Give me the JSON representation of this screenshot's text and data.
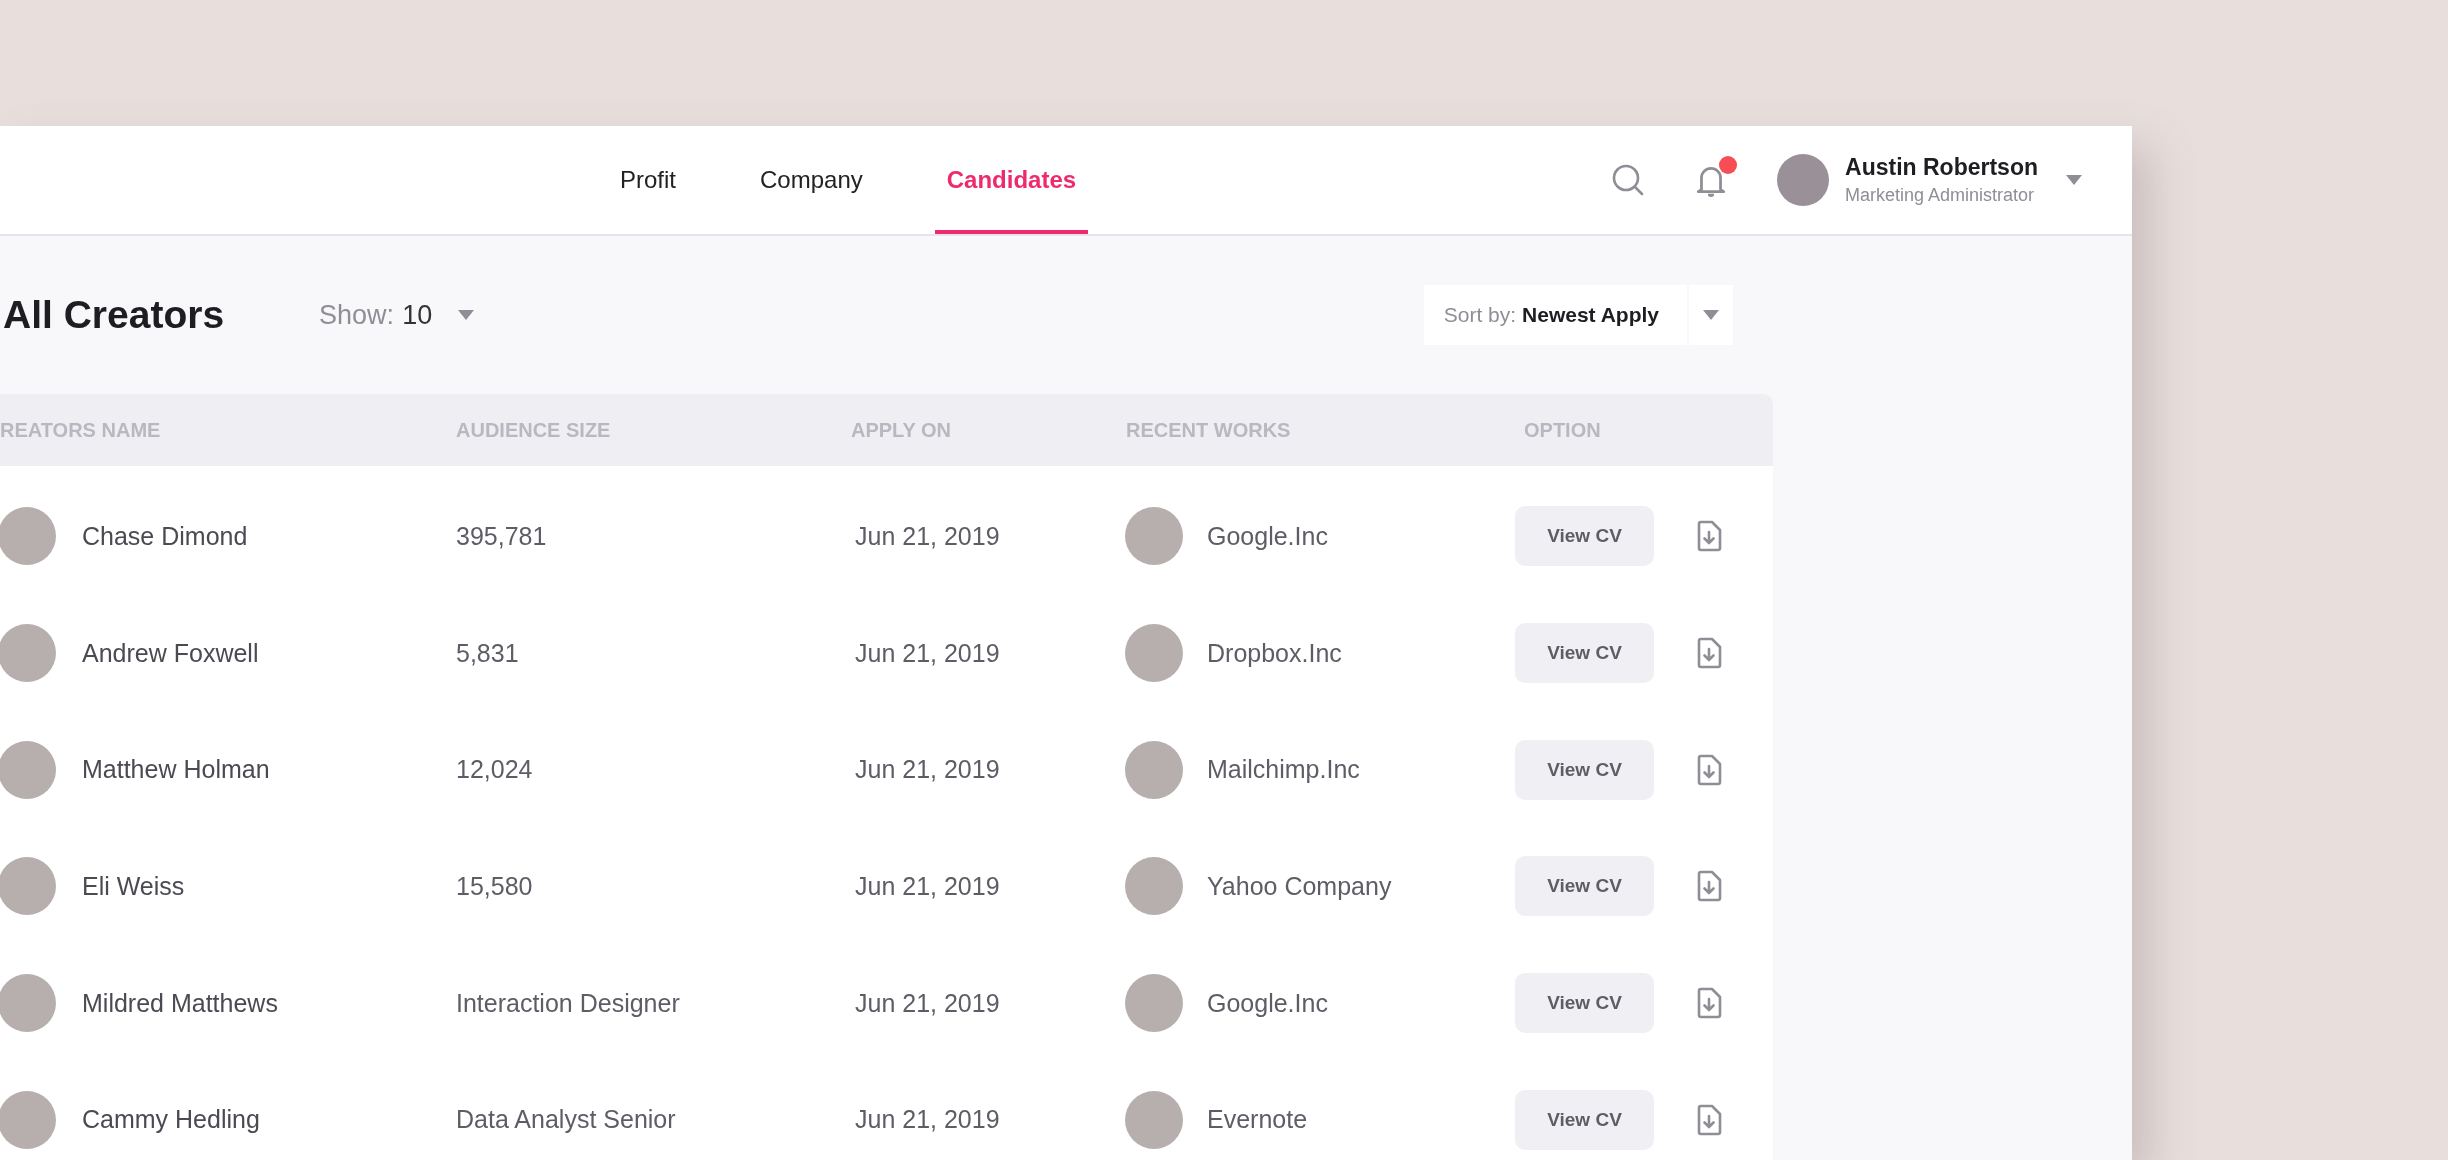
{
  "nav": {
    "tabs": [
      {
        "label": "Profit",
        "selected": false
      },
      {
        "label": "Company",
        "selected": false
      },
      {
        "label": "Candidates",
        "selected": true
      }
    ]
  },
  "user": {
    "name": "Austin Robertson",
    "role": "Marketing Administrator",
    "has_notification": true
  },
  "toolbar": {
    "title": "All Creators",
    "show_label": "Show:",
    "show_value": "10",
    "sort_label": "Sort by:",
    "sort_value": "Newest Apply"
  },
  "table": {
    "columns": [
      "REATORS NAME",
      "AUDIENCE SIZE",
      "APPLY ON",
      "RECENT WORKS",
      "OPTION"
    ],
    "rows": [
      {
        "name": "Chase Dimond",
        "audience": "395,781",
        "applied": "Jun 21, 2019",
        "work": "Google.Inc",
        "action": "View CV"
      },
      {
        "name": "Andrew Foxwell",
        "audience": "5,831",
        "applied": "Jun 21, 2019",
        "work": "Dropbox.Inc",
        "action": "View CV"
      },
      {
        "name": "Matthew Holman",
        "audience": "12,024",
        "applied": "Jun 21, 2019",
        "work": "Mailchimp.Inc",
        "action": "View CV"
      },
      {
        "name": "Eli Weiss",
        "audience": "15,580",
        "applied": "Jun 21, 2019",
        "work": "Yahoo Company",
        "action": "View CV"
      },
      {
        "name": "Mildred Matthews",
        "audience": "Interaction Designer",
        "applied": "Jun 21, 2019",
        "work": "Google.Inc",
        "action": "View CV"
      },
      {
        "name": "Cammy Hedling",
        "audience": "Data Analyst Senior",
        "applied": "Jun 21, 2019",
        "work": "Evernote",
        "action": "View CV"
      }
    ]
  }
}
